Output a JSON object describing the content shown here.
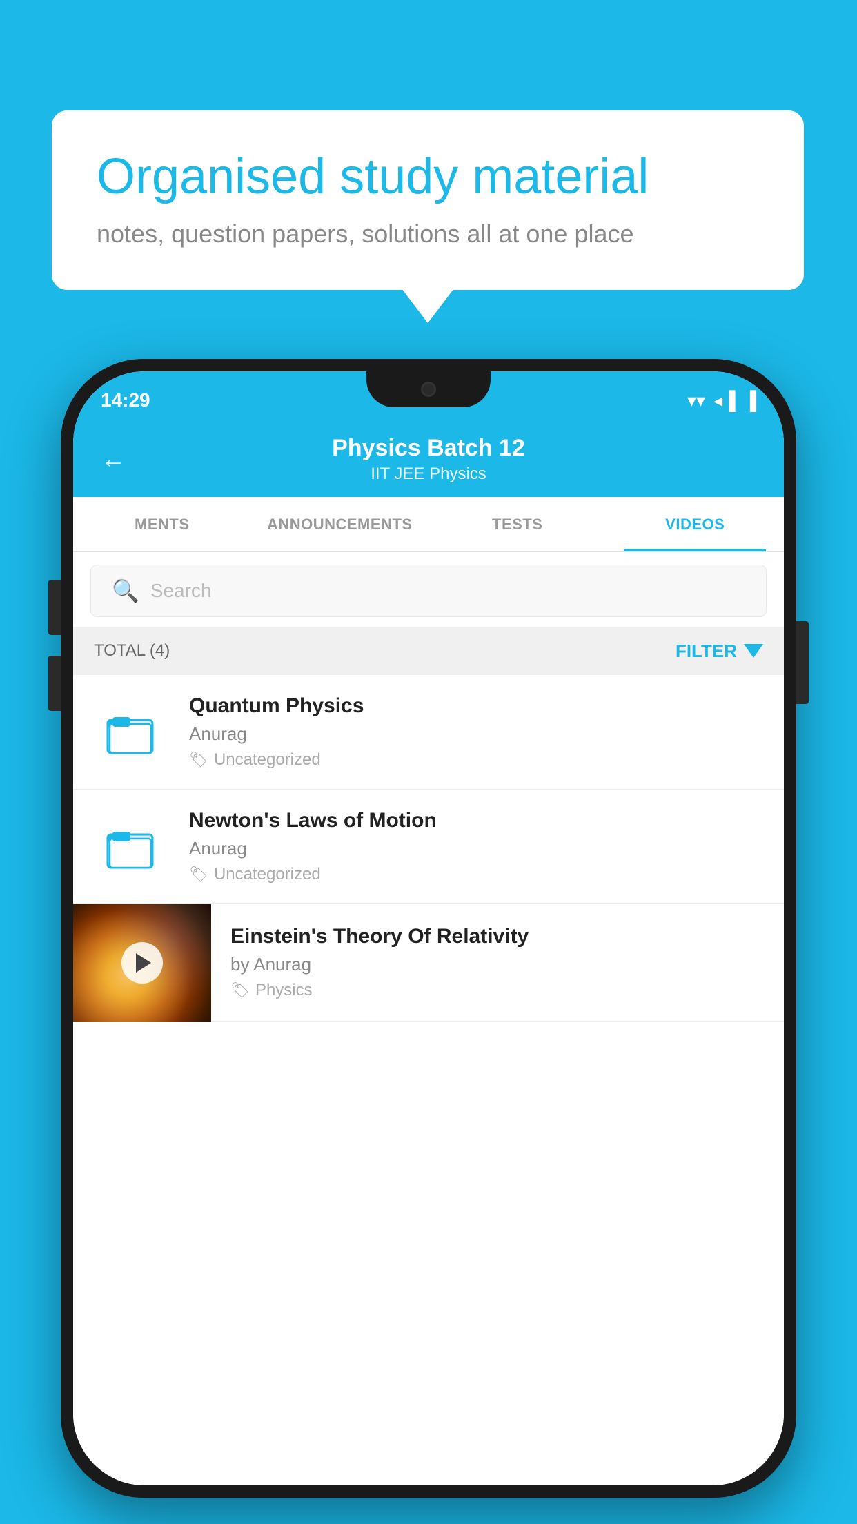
{
  "background_color": "#1BB8E8",
  "speech_bubble": {
    "title": "Organised study material",
    "subtitle": "notes, question papers, solutions all at one place"
  },
  "phone": {
    "status_bar": {
      "time": "14:29",
      "wifi": "▼",
      "signal": "◂",
      "battery": "▐"
    },
    "header": {
      "back_label": "←",
      "title": "Physics Batch 12",
      "subtitle": "IIT JEE   Physics"
    },
    "tabs": [
      {
        "label": "MENTS",
        "active": false
      },
      {
        "label": "ANNOUNCEMENTS",
        "active": false
      },
      {
        "label": "TESTS",
        "active": false
      },
      {
        "label": "VIDEOS",
        "active": true
      }
    ],
    "search": {
      "placeholder": "Search"
    },
    "filter_row": {
      "total_label": "TOTAL (4)",
      "filter_label": "FILTER"
    },
    "videos": [
      {
        "id": 1,
        "title": "Quantum Physics",
        "author": "Anurag",
        "tag": "Uncategorized",
        "has_thumb": false
      },
      {
        "id": 2,
        "title": "Newton's Laws of Motion",
        "author": "Anurag",
        "tag": "Uncategorized",
        "has_thumb": false
      },
      {
        "id": 3,
        "title": "Einstein's Theory Of Relativity",
        "author": "by Anurag",
        "tag": "Physics",
        "has_thumb": true
      }
    ]
  }
}
